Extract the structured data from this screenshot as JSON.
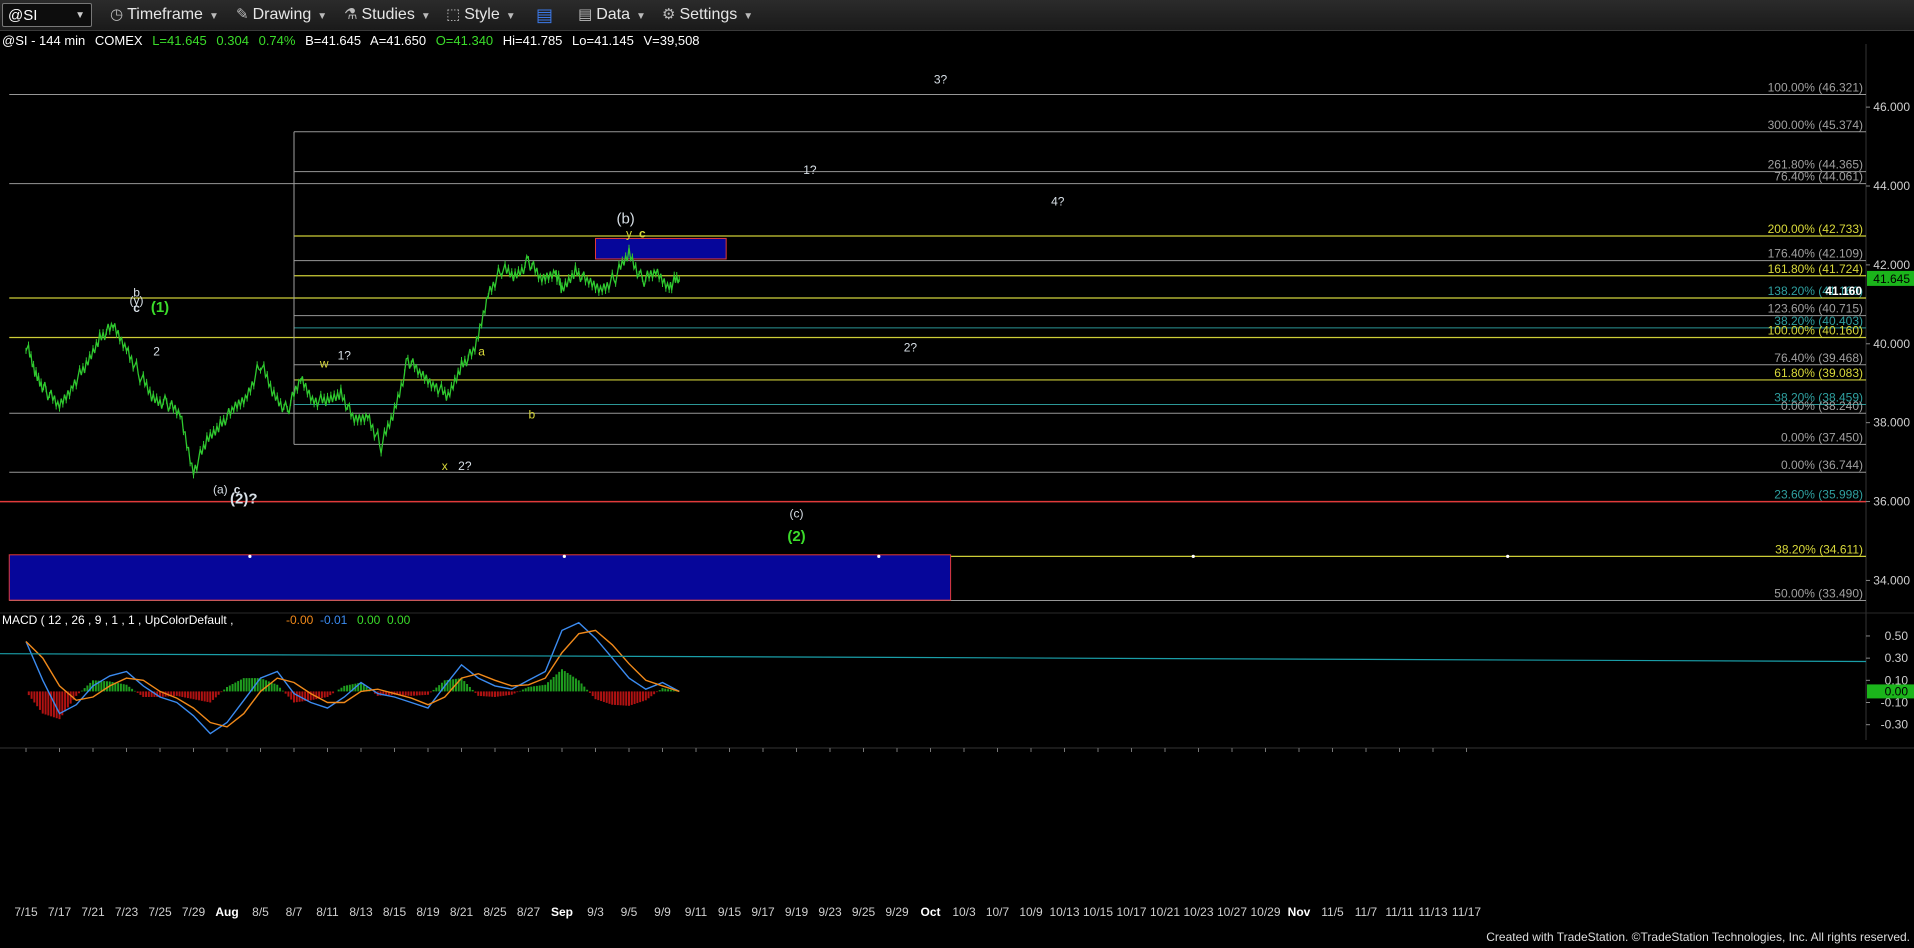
{
  "toolbar": {
    "symbol": "@SI",
    "timeframe": "Timeframe",
    "drawing": "Drawing",
    "studies": "Studies",
    "style": "Style",
    "data": "Data",
    "settings": "Settings"
  },
  "quote": {
    "title": "@SI - 144 min",
    "exchange": "COMEX",
    "last": "L=41.645",
    "change": "0.304",
    "pct": "0.74%",
    "bid": "B=41.645",
    "ask": "A=41.650",
    "open": "O=41.340",
    "high": "Hi=41.785",
    "low": "Lo=41.145",
    "volume": "V=39,508"
  },
  "colors": {
    "background": "#000000",
    "price": "#2fc92f",
    "fib_gray": "#a0a0a0",
    "fib_yellow": "#d9d93a",
    "fib_teal": "#2fa0a0",
    "wave_yellow": "#e8d84a",
    "wave_green": "#3bdc2a",
    "wave_white": "#d7dfe6",
    "box_blue": "#06069a",
    "box_border": "#e23a3a",
    "macd_line": "#3b8bf0",
    "signal_line": "#f0891a",
    "hist_up": "#1f9d1f",
    "hist_down": "#b01212",
    "trend_teal": "#1a9ea8",
    "last_price_bg": "#1bb51b"
  },
  "chart_data": {
    "type": "line",
    "title": "@SI - 144 min",
    "ylim": [
      33.2,
      47.6
    ],
    "y_ticks": [
      "46.000",
      "44.000",
      "42.000",
      "40.000",
      "38.000",
      "36.000",
      "34.000"
    ],
    "y_tick_values": [
      46,
      44,
      42,
      40,
      38,
      36,
      34
    ],
    "x_labels": [
      "7/15",
      "7/17",
      "7/21",
      "7/23",
      "7/25",
      "7/29",
      "Aug",
      "8/5",
      "8/7",
      "8/11",
      "8/13",
      "8/15",
      "8/19",
      "8/21",
      "8/25",
      "8/27",
      "Sep",
      "9/3",
      "9/5",
      "9/9",
      "9/11",
      "9/15",
      "9/17",
      "9/19",
      "9/23",
      "9/25",
      "9/29",
      "Oct",
      "10/3",
      "10/7",
      "10/9",
      "10/13",
      "10/15",
      "10/17",
      "10/21",
      "10/23",
      "10/27",
      "10/29",
      "Nov",
      "11/5",
      "11/7",
      "11/11",
      "11/13",
      "11/17"
    ],
    "x_label_index": [
      0,
      1,
      2,
      3,
      4,
      5,
      6,
      7,
      8,
      9,
      10,
      11,
      12,
      13,
      14,
      15,
      16,
      17,
      18,
      19,
      20,
      21,
      22,
      23,
      24,
      25,
      26,
      27,
      28,
      29,
      30,
      31,
      32,
      33,
      34,
      35,
      36,
      37,
      38,
      39,
      40,
      41,
      42,
      43
    ],
    "price_series": {
      "name": "@SI",
      "x": [
        0,
        0.3,
        0.6,
        1,
        1.4,
        1.8,
        2.2,
        2.6,
        3,
        3.4,
        3.8,
        4.2,
        4.6,
        5,
        5.4,
        5.8,
        6.2,
        6.6,
        7,
        7.4,
        7.8,
        8.2,
        8.6,
        9,
        9.4,
        9.8,
        10.2,
        10.6,
        11,
        11.4,
        11.8,
        12.2,
        12.6,
        13,
        13.4,
        13.8,
        14.2,
        14.6,
        15,
        15.4,
        15.8,
        16,
        16.4,
        16.8,
        17.2,
        17.6,
        18,
        18.4,
        18.8,
        19.2,
        19.5
      ],
      "y": [
        40.0,
        39.2,
        38.8,
        38.4,
        39.0,
        39.4,
        40.2,
        40.4,
        39.9,
        39.2,
        38.6,
        38.5,
        38.2,
        36.8,
        37.5,
        38.0,
        38.3,
        38.7,
        39.5,
        38.7,
        38.3,
        39.1,
        38.6,
        38.5,
        38.8,
        38.0,
        38.2,
        37.4,
        38.3,
        39.6,
        39.2,
        39.0,
        38.6,
        39.5,
        39.8,
        41.3,
        41.9,
        41.7,
        42.1,
        41.6,
        41.9,
        41.3,
        41.9,
        41.5,
        41.4,
        41.7,
        42.3,
        41.6,
        41.8,
        41.5,
        41.645
      ]
    },
    "last_price": 41.645,
    "fib_levels": [
      {
        "label": "100.00% (46.321)",
        "value": 46.321,
        "color": "gray",
        "x_start": -0.5
      },
      {
        "label": "300.00% (45.374)",
        "value": 45.374,
        "color": "gray",
        "x_start": 8.0
      },
      {
        "label": "261.80% (44.365)",
        "value": 44.365,
        "color": "gray",
        "x_start": 8.0
      },
      {
        "label": "76.40% (44.061)",
        "value": 44.061,
        "color": "gray",
        "x_start": -0.5
      },
      {
        "label": "200.00% (42.733)",
        "value": 42.733,
        "color": "yellow",
        "x_start": 8.0
      },
      {
        "label": "176.40% (42.109)",
        "value": 42.109,
        "color": "gray",
        "x_start": 8.0
      },
      {
        "label": "161.80% (41.724)",
        "value": 41.724,
        "color": "yellow",
        "x_start": 8.0
      },
      {
        "label": "138.20% (41.160)",
        "value": 41.16,
        "color": "teal",
        "x_start": 8.0
      },
      {
        "label": "41.160",
        "value": 41.16,
        "color": "yellow",
        "x_start": -0.5
      },
      {
        "label": "123.60% (40.715)",
        "value": 40.715,
        "color": "gray",
        "x_start": 8.0
      },
      {
        "label": "38.20% (40.403)",
        "value": 40.403,
        "color": "teal",
        "x_start": 8.0
      },
      {
        "label": "100.00% (40.160)",
        "value": 40.16,
        "color": "yellow",
        "x_start": -0.5
      },
      {
        "label": "76.40% (39.468)",
        "value": 39.468,
        "color": "gray",
        "x_start": 8.0
      },
      {
        "label": "61.80% (39.083)",
        "value": 39.083,
        "color": "yellow",
        "x_start": 8.0
      },
      {
        "label": "38.20% (38.459)",
        "value": 38.459,
        "color": "teal",
        "x_start": 8.0
      },
      {
        "label": "0.00% (38.240)",
        "value": 38.24,
        "color": "gray",
        "x_start": -0.5
      },
      {
        "label": "0.00% (37.450)",
        "value": 37.45,
        "color": "gray",
        "x_start": 8.0
      },
      {
        "label": "0.00% (36.744)",
        "value": 36.744,
        "color": "gray",
        "x_start": -0.5
      },
      {
        "label": "23.60% (35.998)",
        "value": 35.998,
        "color": "teal",
        "x_start": -0.5
      },
      {
        "label": "38.20% (34.611)",
        "value": 34.611,
        "color": "yellow",
        "x_start": -0.5
      },
      {
        "label": "50.00% (33.490)",
        "value": 33.49,
        "color": "gray",
        "x_start": -0.5
      }
    ],
    "support_line": {
      "value": 35.998,
      "color": "red"
    },
    "boxes": [
      {
        "name": "target-box-upper",
        "x0": 17.0,
        "x1": 20.9,
        "y0": 42.67,
        "y1": 42.15
      },
      {
        "name": "target-box-lower",
        "x0": -0.5,
        "x1": 27.6,
        "y0": 34.65,
        "y1": 33.5
      }
    ],
    "wave_labels": [
      {
        "text": "3?",
        "x": 27.3,
        "y": 46.6,
        "color": "white"
      },
      {
        "text": "1?",
        "x": 23.4,
        "y": 44.3,
        "color": "white"
      },
      {
        "text": "4?",
        "x": 30.8,
        "y": 43.5,
        "color": "white"
      },
      {
        "text": "(b)",
        "x": 17.9,
        "y": 43.05,
        "color": "white"
      },
      {
        "text": "y",
        "x": 18.0,
        "y": 42.7,
        "color": "yellow"
      },
      {
        "text": "c",
        "x": 18.4,
        "y": 42.7,
        "color": "yellow"
      },
      {
        "text": "b",
        "x": 3.3,
        "y": 41.2,
        "color": "white"
      },
      {
        "text": "(y)",
        "x": 3.3,
        "y": 41.0,
        "color": "white"
      },
      {
        "text": "c",
        "x": 3.3,
        "y": 40.8,
        "color": "white"
      },
      {
        "text": "(1)",
        "x": 4.0,
        "y": 40.8,
        "color": "green"
      },
      {
        "text": "2",
        "x": 3.9,
        "y": 39.7,
        "color": "white"
      },
      {
        "text": "w",
        "x": 8.9,
        "y": 39.4,
        "color": "yellow"
      },
      {
        "text": "1?",
        "x": 9.5,
        "y": 39.6,
        "color": "white"
      },
      {
        "text": "a",
        "x": 13.6,
        "y": 39.7,
        "color": "yellow"
      },
      {
        "text": "2?",
        "x": 26.4,
        "y": 39.8,
        "color": "white"
      },
      {
        "text": "b",
        "x": 15.1,
        "y": 38.1,
        "color": "yellow"
      },
      {
        "text": "x",
        "x": 12.5,
        "y": 36.8,
        "color": "yellow"
      },
      {
        "text": "2?",
        "x": 13.1,
        "y": 36.8,
        "color": "white"
      },
      {
        "text": "(a)",
        "x": 5.8,
        "y": 36.2,
        "color": "white"
      },
      {
        "text": "c",
        "x": 6.3,
        "y": 36.2,
        "color": "white"
      },
      {
        "text": "(2)?",
        "x": 6.5,
        "y": 35.95,
        "color": "white"
      },
      {
        "text": "(c)",
        "x": 23.0,
        "y": 35.6,
        "color": "white"
      },
      {
        "text": "(2)",
        "x": 23.0,
        "y": 35.0,
        "color": "green"
      }
    ]
  },
  "macd": {
    "label": "MACD ( 12 , 26 , 9 , 1 , 1 , UpColorDefault ,",
    "v1": "-0.00",
    "v2": "-0.01",
    "v3": "0.00",
    "v4": "0.00",
    "ylim": [
      -0.42,
      0.68
    ],
    "y_ticks": [
      "0.50",
      "0.30",
      "0.10",
      "-0.10",
      "-0.30"
    ],
    "y_tick_values": [
      0.5,
      0.3,
      0.1,
      -0.1,
      -0.3
    ],
    "last_label": "0.00",
    "macd_x": [
      0,
      0.5,
      1,
      1.5,
      2,
      2.5,
      3,
      3.5,
      4,
      4.5,
      5,
      5.5,
      6,
      6.5,
      7,
      7.5,
      8,
      8.5,
      9,
      9.5,
      10,
      10.5,
      11,
      11.5,
      12,
      12.5,
      13,
      13.5,
      14,
      14.5,
      15,
      15.5,
      16,
      16.5,
      17,
      17.5,
      18,
      18.5,
      19,
      19.5
    ],
    "macd_y": [
      0.45,
      0.1,
      -0.2,
      -0.12,
      0.05,
      0.14,
      0.18,
      0.05,
      -0.05,
      -0.1,
      -0.22,
      -0.38,
      -0.28,
      -0.08,
      0.12,
      0.18,
      -0.02,
      -0.1,
      -0.15,
      -0.05,
      0.08,
      -0.02,
      -0.05,
      -0.1,
      -0.15,
      0.05,
      0.24,
      0.12,
      0.05,
      0.02,
      0.1,
      0.18,
      0.55,
      0.62,
      0.48,
      0.3,
      0.12,
      0.02,
      0.08,
      0.0
    ],
    "signal_y": [
      0.45,
      0.3,
      0.05,
      -0.08,
      -0.05,
      0.05,
      0.12,
      0.1,
      0.0,
      -0.06,
      -0.15,
      -0.28,
      -0.32,
      -0.2,
      0.0,
      0.12,
      0.08,
      -0.02,
      -0.1,
      -0.1,
      0.0,
      0.02,
      -0.02,
      -0.06,
      -0.12,
      -0.05,
      0.12,
      0.16,
      0.1,
      0.05,
      0.06,
      0.12,
      0.35,
      0.52,
      0.55,
      0.42,
      0.25,
      0.1,
      0.05,
      0.0
    ],
    "trend": {
      "x0": -0.5,
      "y0": 0.34,
      "x1": 43.5,
      "y1": 0.27
    }
  },
  "footer": "Created with TradeStation. ©TradeStation Technologies, Inc. All rights reserved."
}
